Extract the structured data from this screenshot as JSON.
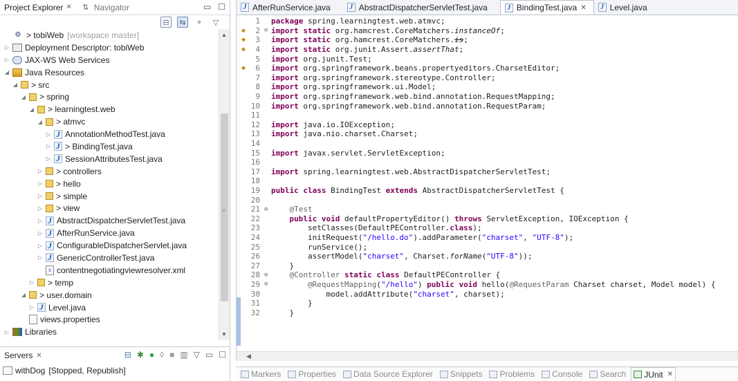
{
  "project_explorer": {
    "tab_label": "Project Explorer",
    "navigator_tab": "Navigator",
    "tree": [
      {
        "indent": 0,
        "twisty": "",
        "icon": "project-icon",
        "label": "> tobiWeb",
        "suffix": "[workspace master]"
      },
      {
        "indent": 0,
        "twisty": "collapsed",
        "icon": "deployment-descriptor-icon",
        "label": "Deployment Descriptor: tobiWeb",
        "suffix": ""
      },
      {
        "indent": 0,
        "twisty": "collapsed",
        "icon": "web-services-icon",
        "label": "JAX-WS Web Services",
        "suffix": ""
      },
      {
        "indent": 0,
        "twisty": "expanded",
        "icon": "java-resources-icon",
        "label": "Java Resources",
        "suffix": ""
      },
      {
        "indent": 1,
        "twisty": "expanded",
        "icon": "source-folder-icon",
        "label": "> src",
        "suffix": ""
      },
      {
        "indent": 2,
        "twisty": "expanded",
        "icon": "package-icon",
        "label": "> spring",
        "suffix": ""
      },
      {
        "indent": 3,
        "twisty": "expanded",
        "icon": "package-icon",
        "label": "> learningtest.web",
        "suffix": ""
      },
      {
        "indent": 4,
        "twisty": "expanded",
        "icon": "package-icon",
        "label": "> atmvc",
        "suffix": ""
      },
      {
        "indent": 5,
        "twisty": "collapsed",
        "icon": "java-file-icon",
        "label": "AnnotationMethodTest.java",
        "suffix": ""
      },
      {
        "indent": 5,
        "twisty": "collapsed",
        "icon": "java-file-icon",
        "label": "> BindingTest.java",
        "suffix": ""
      },
      {
        "indent": 5,
        "twisty": "collapsed",
        "icon": "java-file-icon",
        "label": "SessionAttributesTest.java",
        "suffix": ""
      },
      {
        "indent": 4,
        "twisty": "collapsed",
        "icon": "package-icon",
        "label": "> controllers",
        "suffix": ""
      },
      {
        "indent": 4,
        "twisty": "collapsed",
        "icon": "package-icon",
        "label": "> hello",
        "suffix": ""
      },
      {
        "indent": 4,
        "twisty": "collapsed",
        "icon": "package-icon",
        "label": "> simple",
        "suffix": ""
      },
      {
        "indent": 4,
        "twisty": "collapsed",
        "icon": "package-icon",
        "label": "> view",
        "suffix": ""
      },
      {
        "indent": 4,
        "twisty": "collapsed",
        "icon": "java-file-icon",
        "label": "AbstractDispatcherServletTest.java",
        "suffix": ""
      },
      {
        "indent": 4,
        "twisty": "collapsed",
        "icon": "java-file-icon",
        "label": "AfterRunService.java",
        "suffix": ""
      },
      {
        "indent": 4,
        "twisty": "collapsed",
        "icon": "java-file-icon",
        "label": "ConfigurableDispatcherServlet.java",
        "suffix": ""
      },
      {
        "indent": 4,
        "twisty": "collapsed",
        "icon": "java-file-icon",
        "label": "GenericControllerTest.java",
        "suffix": ""
      },
      {
        "indent": 4,
        "twisty": "",
        "icon": "xml-file-icon",
        "label": "contentnegotiatingviewresolver.xml",
        "suffix": ""
      },
      {
        "indent": 3,
        "twisty": "collapsed",
        "icon": "package-icon",
        "label": "> temp",
        "suffix": ""
      },
      {
        "indent": 2,
        "twisty": "expanded",
        "icon": "package-icon",
        "label": "> user.domain",
        "suffix": ""
      },
      {
        "indent": 3,
        "twisty": "collapsed",
        "icon": "java-file-icon",
        "label": "Level.java",
        "suffix": ""
      },
      {
        "indent": 2,
        "twisty": "",
        "icon": "properties-file-icon",
        "label": "views.properties",
        "suffix": ""
      },
      {
        "indent": 0,
        "twisty": "collapsed",
        "icon": "libraries-icon",
        "label": "Libraries",
        "suffix": ""
      }
    ]
  },
  "servers": {
    "tab_label": "Servers",
    "items": [
      {
        "label": "withDog",
        "status": "[Stopped, Republish]"
      }
    ]
  },
  "editor": {
    "tabs": [
      {
        "label": "AfterRunService.java",
        "active": false
      },
      {
        "label": "AbstractDispatcherServletTest.java",
        "active": false
      },
      {
        "label": "BindingTest.java",
        "active": true
      },
      {
        "label": "Level.java",
        "active": false
      }
    ],
    "lines": [
      {
        "n": "1",
        "g": "",
        "f": "",
        "t": "package spring.learningtest.web.atmvc;"
      },
      {
        "n": "2",
        "g": "warn",
        "f": "⊖",
        "t": "import static org.hamcrest.CoreMatchers.instanceOf;"
      },
      {
        "n": "3",
        "g": "warn",
        "f": "",
        "t": "import static org.hamcrest.CoreMatchers.is;"
      },
      {
        "n": "4",
        "g": "warn",
        "f": "",
        "t": "import static org.junit.Assert.assertThat;"
      },
      {
        "n": "5",
        "g": "",
        "f": "",
        "t": "import org.junit.Test;"
      },
      {
        "n": "6",
        "g": "warn",
        "f": "",
        "t": "import org.springframework.beans.propertyeditors.CharsetEditor;"
      },
      {
        "n": "7",
        "g": "",
        "f": "",
        "t": "import org.springframework.stereotype.Controller;"
      },
      {
        "n": "8",
        "g": "",
        "f": "",
        "t": "import org.springframework.ui.Model;"
      },
      {
        "n": "9",
        "g": "",
        "f": "",
        "t": "import org.springframework.web.bind.annotation.RequestMapping;"
      },
      {
        "n": "10",
        "g": "",
        "f": "",
        "t": "import org.springframework.web.bind.annotation.RequestParam;"
      },
      {
        "n": "11",
        "g": "",
        "f": "",
        "t": ""
      },
      {
        "n": "12",
        "g": "",
        "f": "",
        "t": "import java.io.IOException;"
      },
      {
        "n": "13",
        "g": "",
        "f": "",
        "t": "import java.nio.charset.Charset;"
      },
      {
        "n": "14",
        "g": "",
        "f": "",
        "t": ""
      },
      {
        "n": "15",
        "g": "",
        "f": "",
        "t": "import javax.servlet.ServletException;"
      },
      {
        "n": "16",
        "g": "",
        "f": "",
        "t": ""
      },
      {
        "n": "17",
        "g": "",
        "f": "",
        "t": "import spring.learningtest.web.AbstractDispatcherServletTest;"
      },
      {
        "n": "18",
        "g": "",
        "f": "",
        "t": ""
      },
      {
        "n": "19",
        "g": "",
        "f": "",
        "t": "public class BindingTest extends AbstractDispatcherServletTest {"
      },
      {
        "n": "20",
        "g": "",
        "f": "",
        "t": ""
      },
      {
        "n": "21",
        "g": "",
        "f": "⊖",
        "t": "    @Test"
      },
      {
        "n": "22",
        "g": "",
        "f": "",
        "t": "    public void defaultPropertyEditor() throws ServletException, IOException {"
      },
      {
        "n": "23",
        "g": "",
        "f": "",
        "t": "        setClasses(DefaultPEController.class);"
      },
      {
        "n": "24",
        "g": "",
        "f": "",
        "t": "        initRequest(\"/hello.do\").addParameter(\"charset\", \"UTF-8\");"
      },
      {
        "n": "25",
        "g": "",
        "f": "",
        "t": "        runService();"
      },
      {
        "n": "26",
        "g": "",
        "f": "",
        "t": "        assertModel(\"charset\", Charset.forName(\"UTF-8\"));"
      },
      {
        "n": "27",
        "g": "",
        "f": "",
        "t": "    }"
      },
      {
        "n": "28",
        "g": "",
        "f": "⊖",
        "t": "    @Controller static class DefaultPEController {"
      },
      {
        "n": "29",
        "g": "",
        "f": "⊖",
        "t": "        @RequestMapping(\"/hello\") public void hello(@RequestParam Charset charset, Model model) {"
      },
      {
        "n": "30",
        "g": "",
        "f": "",
        "t": "            model.addAttribute(\"charset\", charset);"
      },
      {
        "n": "31",
        "g": "",
        "f": "",
        "t": "        }"
      },
      {
        "n": "32",
        "g": "",
        "f": "",
        "t": "    }"
      }
    ]
  },
  "bottom_tabs": [
    {
      "label": "Markers",
      "icon": "markers-icon",
      "active": false
    },
    {
      "label": "Properties",
      "icon": "properties-icon",
      "active": false
    },
    {
      "label": "Data Source Explorer",
      "icon": "data-source-icon",
      "active": false
    },
    {
      "label": "Snippets",
      "icon": "snippets-icon",
      "active": false
    },
    {
      "label": "Problems",
      "icon": "problems-icon",
      "active": false
    },
    {
      "label": "Console",
      "icon": "console-icon",
      "active": false
    },
    {
      "label": "Search",
      "icon": "search-icon",
      "active": false
    },
    {
      "label": "JUnit",
      "icon": "junit-icon",
      "active": true
    }
  ],
  "colors": {
    "keyword": "#7f0055",
    "string": "#2a00ff",
    "annotation": "#646464",
    "italic_static": "#000000",
    "selection_bar": "#a9c1e5"
  }
}
